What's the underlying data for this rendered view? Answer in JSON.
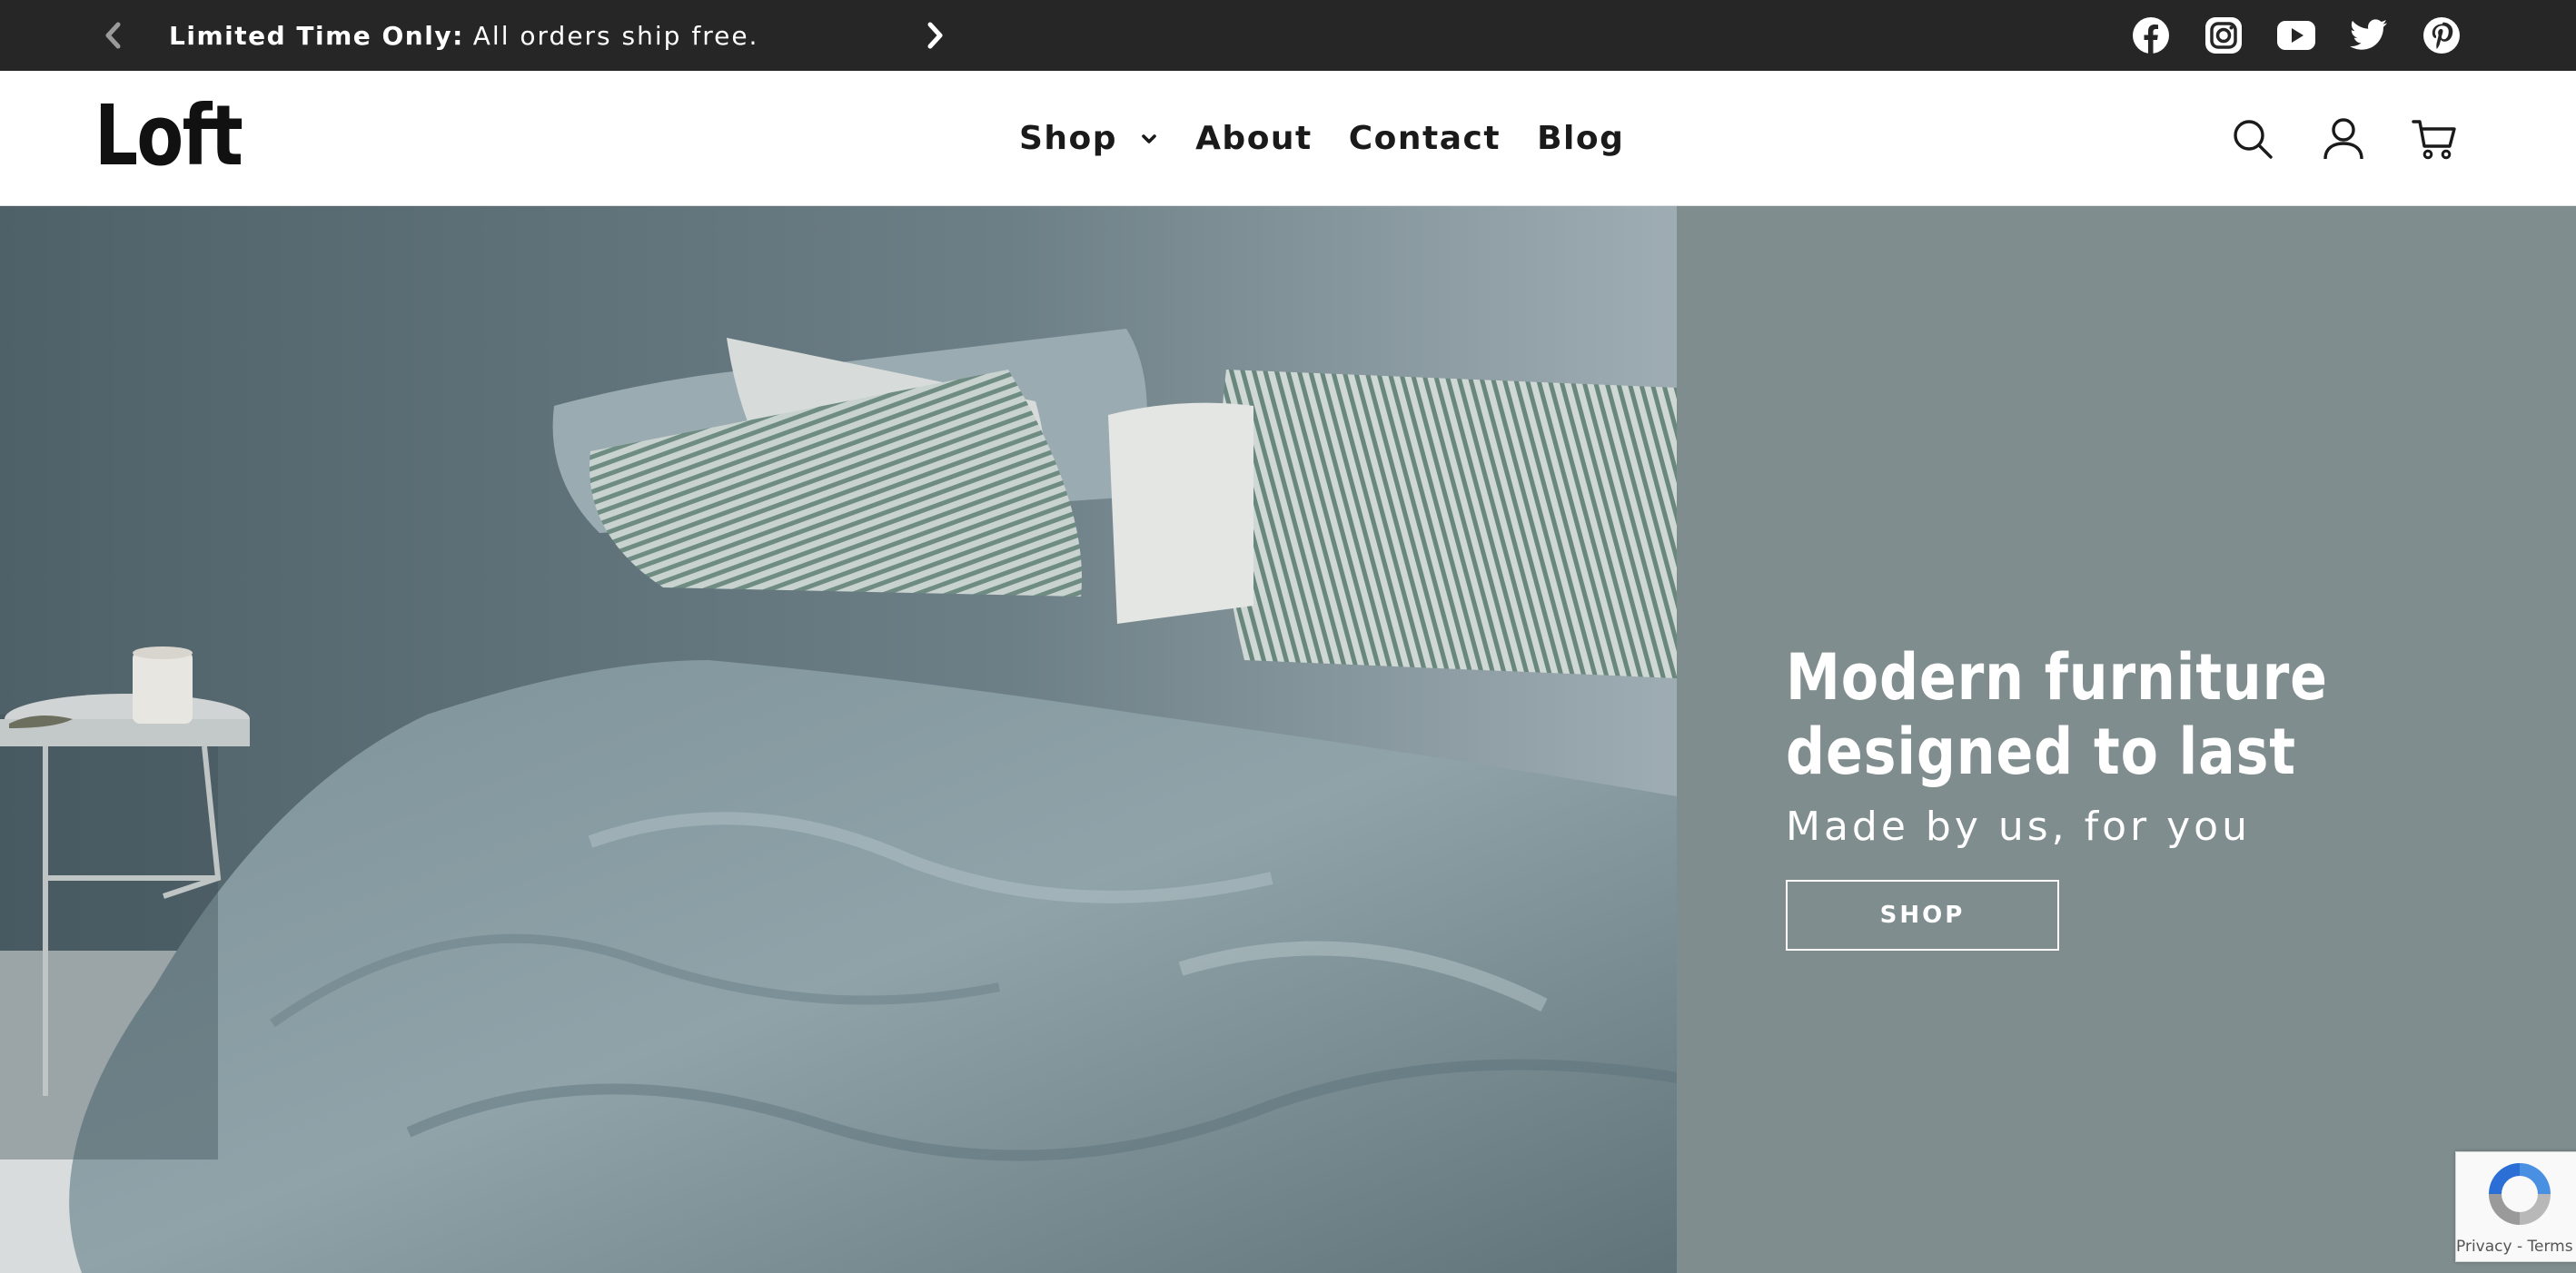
{
  "announcement": {
    "label_bold": "Limited Time Only:",
    "text": "All orders ship free.",
    "prev_icon": "chevron-left-icon",
    "next_icon": "chevron-right-icon"
  },
  "social": [
    "facebook-icon",
    "instagram-icon",
    "youtube-icon",
    "twitter-icon",
    "pinterest-icon"
  ],
  "header": {
    "logo": "Loft",
    "nav": {
      "shop": "Shop",
      "about": "About",
      "contact": "Contact",
      "blog": "Blog"
    },
    "tools": [
      "search-icon",
      "account-icon",
      "cart-icon"
    ]
  },
  "hero": {
    "image_alt": "Bed with rumpled grey-blue linen duvet and striped pillows beside a round side table with a candle",
    "title": "Modern furniture designed to last",
    "subtitle": "Made by us, for you",
    "button_label": "SHOP",
    "panel_color": "#7f8d8e"
  },
  "recaptcha": {
    "links": "Privacy - Terms"
  },
  "colors": {
    "announcement_bg": "#262626",
    "text_dark": "#1a1a1a",
    "hero_panel": "#7f8d8e"
  }
}
